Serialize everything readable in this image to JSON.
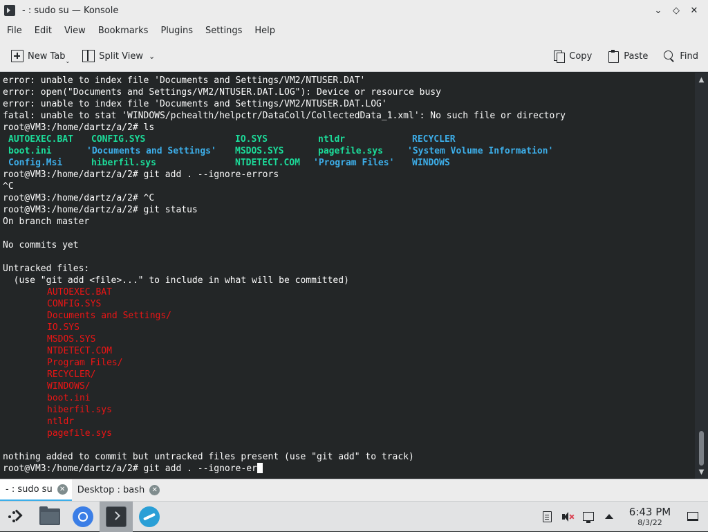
{
  "window": {
    "title": "- : sudo su — Konsole",
    "controls": [
      "minimize",
      "keep-above",
      "close"
    ]
  },
  "menu": [
    "File",
    "Edit",
    "View",
    "Bookmarks",
    "Plugins",
    "Settings",
    "Help"
  ],
  "toolbar": {
    "new_tab": "New Tab",
    "split_view": "Split View",
    "copy": "Copy",
    "paste": "Paste",
    "find": "Find"
  },
  "terminal": {
    "lines_top": [
      "error: unable to index file 'Documents and Settings/VM2/NTUSER.DAT'",
      "error: open(\"Documents and Settings/VM2/NTUSER.DAT.LOG\"): Device or resource busy",
      "error: unable to index file 'Documents and Settings/VM2/NTUSER.DAT.LOG'",
      "fatal: unable to stat 'WINDOWS/pchealth/helpctr/DataColl/CollectedData_1.xml': No such file or directory",
      "root@VM3:/home/dartz/a/2# ls"
    ],
    "ls_output": [
      [
        {
          "text": "AUTOEXEC.BAT",
          "color": "green"
        },
        {
          "text": "CONFIG.SYS",
          "color": "green"
        },
        {
          "text": "IO.SYS",
          "color": "green"
        },
        {
          "text": "ntldr",
          "color": "green"
        },
        {
          "text": "RECYCLER",
          "color": "blue"
        }
      ],
      [
        {
          "text": "boot.ini",
          "color": "green"
        },
        {
          "text": "'Documents and Settings'",
          "color": "blue"
        },
        {
          "text": "MSDOS.SYS",
          "color": "green"
        },
        {
          "text": "pagefile.sys",
          "color": "green"
        },
        {
          "text": "'System Volume Information'",
          "color": "blue"
        }
      ],
      [
        {
          "text": "Config.Msi",
          "color": "blue"
        },
        {
          "text": "hiberfil.sys",
          "color": "green"
        },
        {
          "text": "NTDETECT.COM",
          "color": "green"
        },
        {
          "text": "'Program Files'",
          "color": "blue"
        },
        {
          "text": "WINDOWS",
          "color": "blue"
        }
      ]
    ],
    "lines_mid": [
      "root@VM3:/home/dartz/a/2# git add . --ignore-errors",
      "^C",
      "root@VM3:/home/dartz/a/2# ^C",
      "root@VM3:/home/dartz/a/2# git status",
      "On branch master",
      "",
      "No commits yet",
      "",
      "Untracked files:",
      "  (use \"git add <file>...\" to include in what will be committed)"
    ],
    "untracked": [
      "AUTOEXEC.BAT",
      "CONFIG.SYS",
      "Documents and Settings/",
      "IO.SYS",
      "MSDOS.SYS",
      "NTDETECT.COM",
      "Program Files/",
      "RECYCLER/",
      "WINDOWS/",
      "boot.ini",
      "hiberfil.sys",
      "ntldr",
      "pagefile.sys"
    ],
    "lines_end": [
      "",
      "nothing added to commit but untracked files present (use \"git add\" to track)"
    ],
    "current_prompt": "root@VM3:/home/dartz/a/2# git add . --ignore-er",
    "colors": {
      "background": "#232627",
      "foreground": "#fcfcfc",
      "green": "#1cdc9a",
      "blue": "#3daee9",
      "red": "#ed1515"
    }
  },
  "tabs": [
    {
      "label": "- : sudo su",
      "active": true
    },
    {
      "label": "Desktop : bash",
      "active": false
    }
  ],
  "taskbar": {
    "apps": [
      "application-launcher-icon",
      "file-manager-icon",
      "chromium-icon",
      "konsole-icon",
      "discover-icon"
    ],
    "clock": {
      "time": "6:43 PM",
      "date": "8/3/22"
    }
  }
}
